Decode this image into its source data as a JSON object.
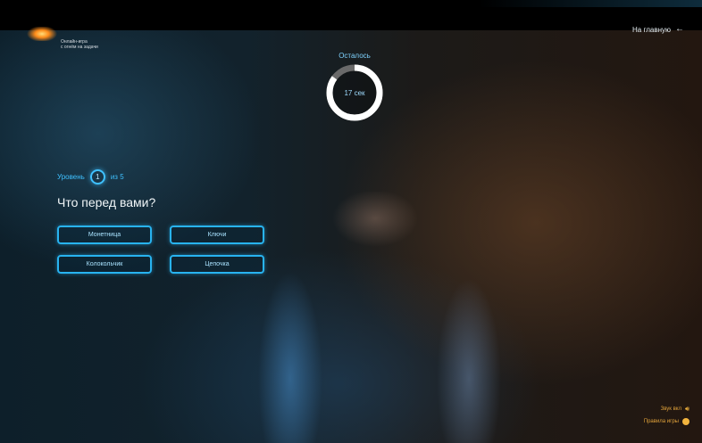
{
  "header": {
    "logo_tagline": "Онлайн-игра\nс огнём на задачи",
    "home_link": "На главную",
    "home_icon": "arrow-left-icon"
  },
  "timer": {
    "label": "Осталось",
    "value": "17 сек",
    "fraction_remaining": 0.85,
    "ring_color": "#ffffff",
    "track_color": "#6a6a6a"
  },
  "level": {
    "label": "Уровень",
    "current": "1",
    "total_text": "из 5"
  },
  "question": {
    "text": "Что перед вами?"
  },
  "answers": [
    {
      "label": "Монетница"
    },
    {
      "label": "Ключи"
    },
    {
      "label": "Колокольчик"
    },
    {
      "label": "Цепочка"
    }
  ],
  "controls": {
    "sound_label": "Звук вкл",
    "sound_icon": "speaker-icon",
    "rules_label": "Правила игры",
    "rules_icon": "info-dot-icon"
  },
  "colors": {
    "accent": "#28b3f0",
    "highlight": "#f2b43e"
  }
}
